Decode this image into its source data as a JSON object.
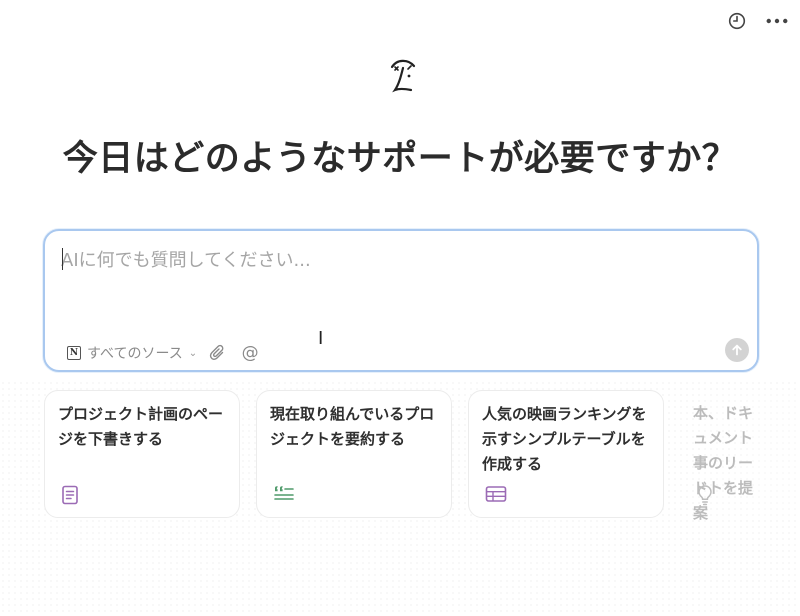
{
  "header": {
    "history_icon": "clock-icon",
    "more_icon": "more-dots-icon"
  },
  "main": {
    "title": "今日はどのようなサポートが必要ですか？"
  },
  "composer": {
    "placeholder": "AIに何でも質問してください...",
    "value": "",
    "source_label": "すべてのソース",
    "source_icon": "notion-icon",
    "attach_icon": "paperclip-icon",
    "mention_label": "@",
    "send_icon": "arrow-up-icon"
  },
  "suggestions": [
    {
      "label": "プロジェクト計画のページを下書きする",
      "icon": "document-icon",
      "color": "#9b6bb5"
    },
    {
      "label": "現在取り組んでいるプロジェクトを要約する",
      "icon": "quote-icon",
      "color": "#4f9a6a"
    },
    {
      "label": "人気の映画ランキングを示すシンプルテーブルを作成する",
      "icon": "table-icon",
      "color": "#9b6bb5"
    },
    {
      "label": "本、ドキュメント事のリードトを提案",
      "icon": "lightbulb-icon",
      "color": "#bdbdbd"
    }
  ]
}
